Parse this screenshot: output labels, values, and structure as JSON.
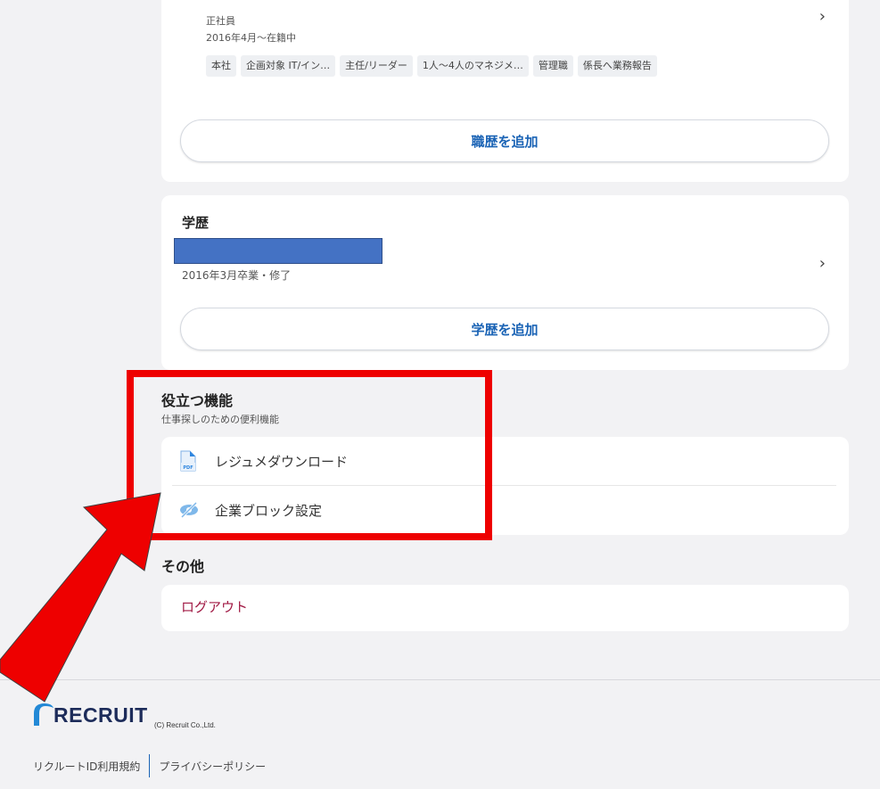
{
  "work_history": {
    "employment_type": "正社員",
    "period": "2016年4月〜在籍中",
    "tags": [
      "本社",
      "企画対象 IT/イン…",
      "主任/リーダー",
      "1人〜4人のマネジメ…",
      "管理職",
      "係長へ業務報告"
    ],
    "add_button_label": "職歴を追加"
  },
  "education": {
    "title": "学歴",
    "graduation": "2016年3月卒業・修了",
    "add_button_label": "学歴を追加"
  },
  "tools": {
    "title": "役立つ機能",
    "subtitle": "仕事探しのための便利機能",
    "items": [
      {
        "label": "レジュメダウンロード",
        "icon": "pdf-file-icon"
      },
      {
        "label": "企業ブロック設定",
        "icon": "eye-slash-icon"
      }
    ]
  },
  "other": {
    "title": "その他",
    "logout_label": "ログアウト"
  },
  "footer": {
    "logo_text": "RECRUIT",
    "copyright": "(C) Recruit Co.,Ltd.",
    "links": [
      "リクルートID利用規約",
      "プライバシーポリシー"
    ]
  },
  "colors": {
    "accent_blue": "#1a63b5",
    "logout_red": "#a01843",
    "annotation_red": "#ee0000"
  }
}
